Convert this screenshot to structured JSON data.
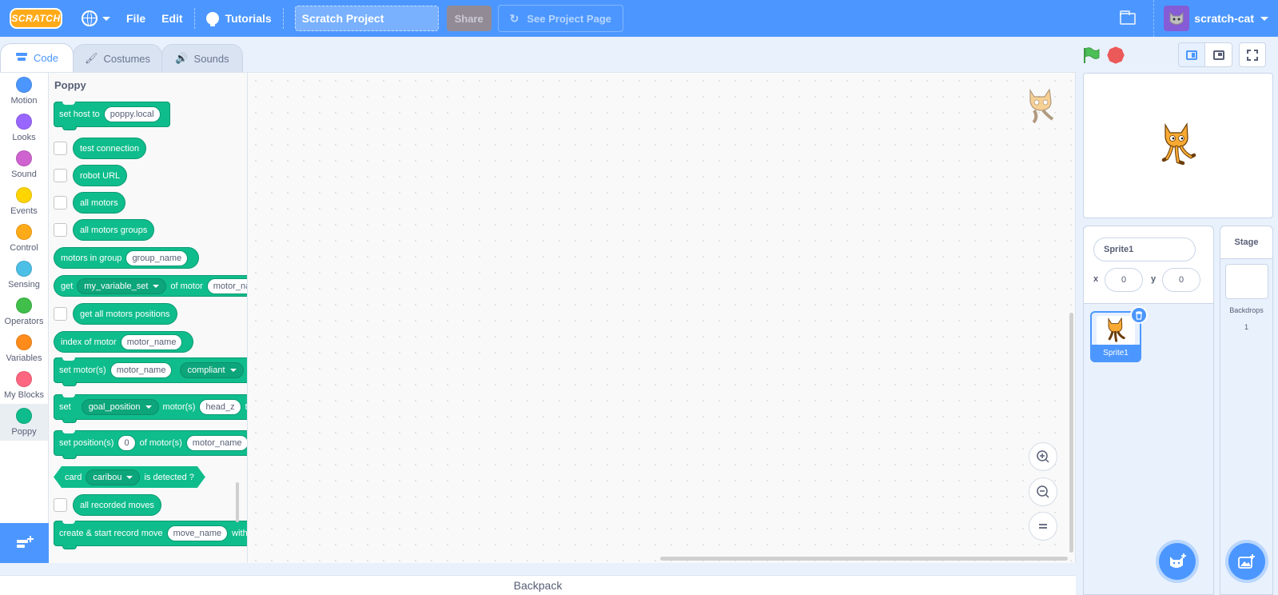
{
  "menubar": {
    "logo_text": "SCRATCH",
    "file_label": "File",
    "edit_label": "Edit",
    "tutorials_label": "Tutorials",
    "project_title": "Scratch Project",
    "share_label": "Share",
    "see_project_label": "See Project Page",
    "username": "scratch-cat"
  },
  "tabs": {
    "code": "Code",
    "costumes": "Costumes",
    "sounds": "Sounds"
  },
  "categories": [
    {
      "label": "Motion",
      "color": "#4c97ff"
    },
    {
      "label": "Looks",
      "color": "#9966ff"
    },
    {
      "label": "Sound",
      "color": "#cf63cf"
    },
    {
      "label": "Events",
      "color": "#ffd500"
    },
    {
      "label": "Control",
      "color": "#ffab19"
    },
    {
      "label": "Sensing",
      "color": "#4cbfe6"
    },
    {
      "label": "Operators",
      "color": "#40bf4a"
    },
    {
      "label": "Variables",
      "color": "#ff8c1a"
    },
    {
      "label": "My Blocks",
      "color": "#ff6680"
    },
    {
      "label": "Poppy",
      "color": "#0fbd8c"
    }
  ],
  "palette": {
    "title": "Poppy",
    "accent": "#0fbd8c",
    "blocks": {
      "set_host": {
        "text": "set host to",
        "value": "poppy.local"
      },
      "test_connection": "test connection",
      "robot_url": "robot URL",
      "all_motors": "all motors",
      "all_motors_groups": "all motors groups",
      "motors_in_group": {
        "text": "motors in group",
        "value": "group_name"
      },
      "get_var": {
        "text1": "get",
        "dropdown": "my_variable_set",
        "text2": "of motor",
        "value": "motor_nar"
      },
      "get_all_positions": "get all motors positions",
      "index_of_motor": {
        "text": "index of motor",
        "value": "motor_name"
      },
      "set_motors": {
        "text": "set motor(s)",
        "value": "motor_name",
        "dropdown": "compliant"
      },
      "set_goal": {
        "text1": "set",
        "dropdown": "goal_position",
        "text2": "motor(s)",
        "value": "head_z",
        "text3": "to"
      },
      "set_position": {
        "text1": "set position(s)",
        "value": "0",
        "text2": "of motor(s)",
        "value2": "motor_name"
      },
      "card_detected": {
        "text1": "card",
        "dropdown": "caribou",
        "text2": "is detected ?"
      },
      "all_recorded_moves": "all recorded moves",
      "create_record": {
        "text1": "create & start record move",
        "value": "move_name",
        "text2": "with"
      }
    }
  },
  "backpack_label": "Backpack",
  "sprite_info": {
    "name": "Sprite1",
    "x_label": "x",
    "x_value": "0",
    "y_label": "y",
    "y_value": "0"
  },
  "sprite_list": [
    {
      "name": "Sprite1"
    }
  ],
  "stage_pane": {
    "title": "Stage",
    "backdrops_label": "Backdrops",
    "backdrops_count": "1"
  },
  "colors": {
    "menubar": "#4c97ff",
    "stop": "#ec5959",
    "flag": "#4cbf56"
  }
}
